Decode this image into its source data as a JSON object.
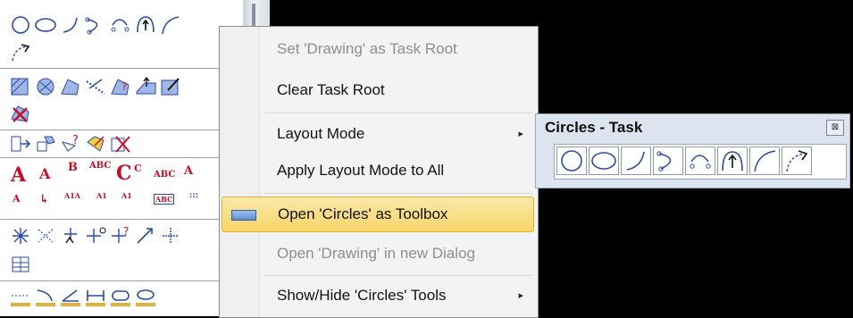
{
  "tool_panel": {
    "text_tools": {
      "a_big": "A",
      "a_arrow": "A",
      "b_text": "B",
      "abc_check": "ABC",
      "c_caps": "C",
      "c_small": "C",
      "abc_q": "ABC",
      "a_up": "A"
    },
    "annot_row": {
      "a1": "A",
      "a2": "A1A",
      "a3": "A2A",
      "a4": "A1",
      "a5": "A1",
      "a6": "A2",
      "a7": "ABC"
    }
  },
  "context_menu": {
    "items": [
      {
        "label": "Set 'Drawing' as Task Root",
        "enabled": false
      },
      {
        "label": "Clear Task Root",
        "enabled": true
      },
      {
        "label": "Layout Mode",
        "enabled": true,
        "submenu": true
      },
      {
        "label": "Apply Layout Mode to All",
        "enabled": true
      },
      {
        "label": "Open 'Circles' as Toolbox",
        "enabled": true,
        "highlighted": true
      },
      {
        "label": "Open 'Drawing' in new Dialog",
        "enabled": false
      },
      {
        "label": "Show/Hide 'Circles' Tools",
        "enabled": true,
        "submenu": true
      }
    ],
    "submenu_arrow": "▸"
  },
  "toolbox": {
    "title": "Circles - Task",
    "close_glyph": "⊠",
    "tools": [
      "place-circle-icon",
      "place-ellipse-icon",
      "place-arc-icon",
      "arc-by-edge-icon",
      "arc-by-points-icon",
      "modify-arc-icon",
      "arc-tangent-icon",
      "modify-arc-radius-icon"
    ]
  },
  "colors": {
    "highlight": "#f7d56a",
    "menu_bg": "#f3f3f3",
    "toolbox_bg": "#dbe4ef",
    "icon_blue": "#2c4aa8",
    "icon_red": "#c0102a"
  }
}
